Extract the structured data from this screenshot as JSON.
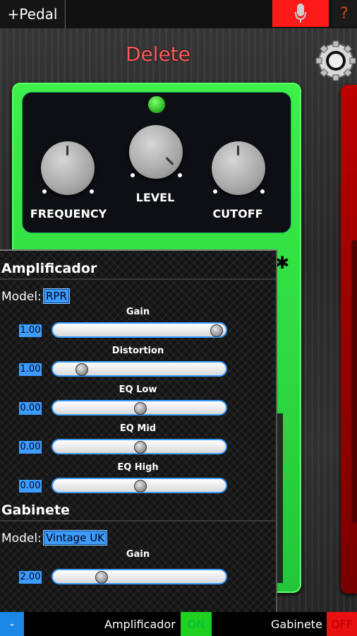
{
  "topbar": {
    "add_pedal_label": "+Pedal",
    "mic_icon": "microphone-icon",
    "help_label": "?"
  },
  "title": "Delete",
  "colors": {
    "title": "#ff5a5a",
    "pedal_green": "#2bd640",
    "accent_blue": "#3c9cff",
    "on_green": "#20d020",
    "off_red": "#e81010"
  },
  "pedal": {
    "knobs": [
      {
        "label": "FREQUENCY"
      },
      {
        "label": "LEVEL"
      },
      {
        "label": "CUTOFF"
      }
    ]
  },
  "amplifier": {
    "title": "Amplificador",
    "model_label": "Model:",
    "model_value": "RPR",
    "params": [
      {
        "name": "Gain",
        "value": "1.00",
        "level": 1.0
      },
      {
        "name": "Distortion",
        "value": "1.00",
        "level": 0.12
      },
      {
        "name": "EQ Low",
        "value": "0.00",
        "level": 0.5
      },
      {
        "name": "EQ Mid",
        "value": "0.00",
        "level": 0.5
      },
      {
        "name": "EQ High",
        "value": "0.00",
        "level": 0.5
      }
    ]
  },
  "cabinet": {
    "title": "Gabinete",
    "model_label": "Model:",
    "model_value": "Vintage UK",
    "params": [
      {
        "name": "Gain",
        "value": "2.00",
        "level": 0.25
      }
    ]
  },
  "bottombar": {
    "minus_label": "-",
    "amp_label": "Amplificador",
    "amp_state": "ON",
    "cab_label": "Gabinete",
    "cab_state": "OFF"
  }
}
